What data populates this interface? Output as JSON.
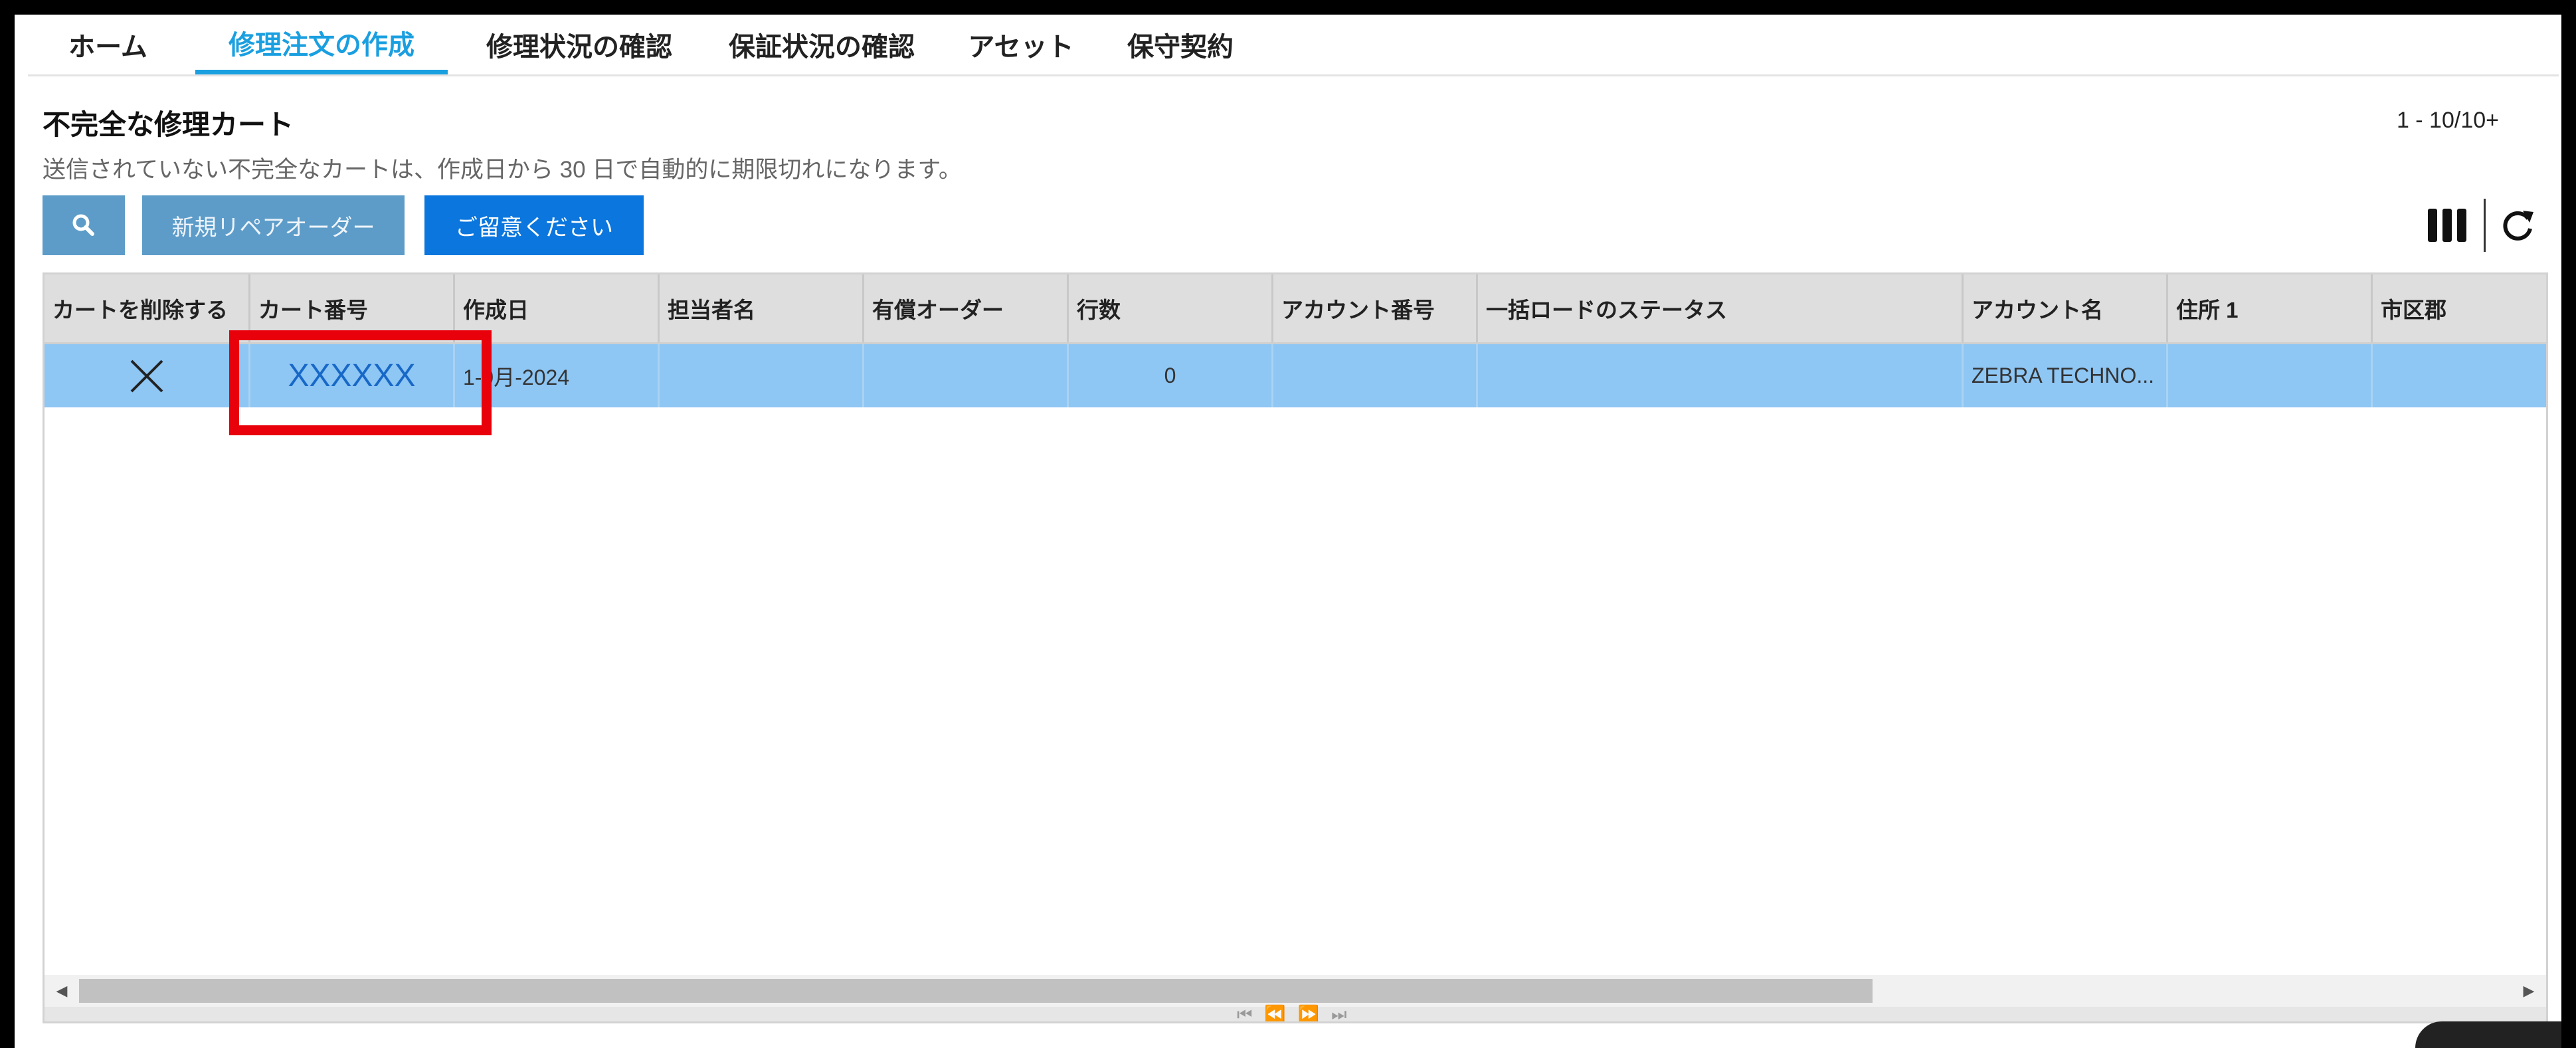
{
  "nav": {
    "tabs": [
      {
        "label": "ホーム"
      },
      {
        "label": "修理注文の作成",
        "active": true
      },
      {
        "label": "修理状況の確認"
      },
      {
        "label": "保証状況の確認"
      },
      {
        "label": "アセット"
      },
      {
        "label": "保守契約"
      }
    ]
  },
  "header": {
    "title": "不完全な修理カート",
    "subtitle": "送信されていない不完全なカートは、作成日から 30 日で自動的に期限切れになります。",
    "paging": "1 - 10/10+"
  },
  "toolbar": {
    "search_icon": "search-icon",
    "new_repair_order": "新規リペアオーダー",
    "notice": "ご留意ください",
    "columns_icon": "columns-icon",
    "refresh_icon": "refresh-icon"
  },
  "grid": {
    "columns": [
      "カートを削除する",
      "カート番号",
      "作成日",
      "担当者名",
      "有償オーダー",
      "行数",
      "アカウント番号",
      "一括ロードのステータス",
      "アカウント名",
      "住所 1",
      "市区郡"
    ],
    "rows": [
      {
        "delete": "×",
        "cart_number": "XXXXXX",
        "created": "1-9月-2024",
        "contact": "",
        "paid_order": "",
        "lines": "0",
        "account_number": "",
        "bulk_status": "",
        "account_name": "ZEBRA TECHNO...",
        "address1": "",
        "city": ""
      }
    ]
  },
  "colors": {
    "accent": "#1a9fe0",
    "button_primary": "#0b76dd",
    "button_secondary": "#5d9cc8",
    "row_selected": "#8ec6f4",
    "highlight": "#e8000b"
  }
}
